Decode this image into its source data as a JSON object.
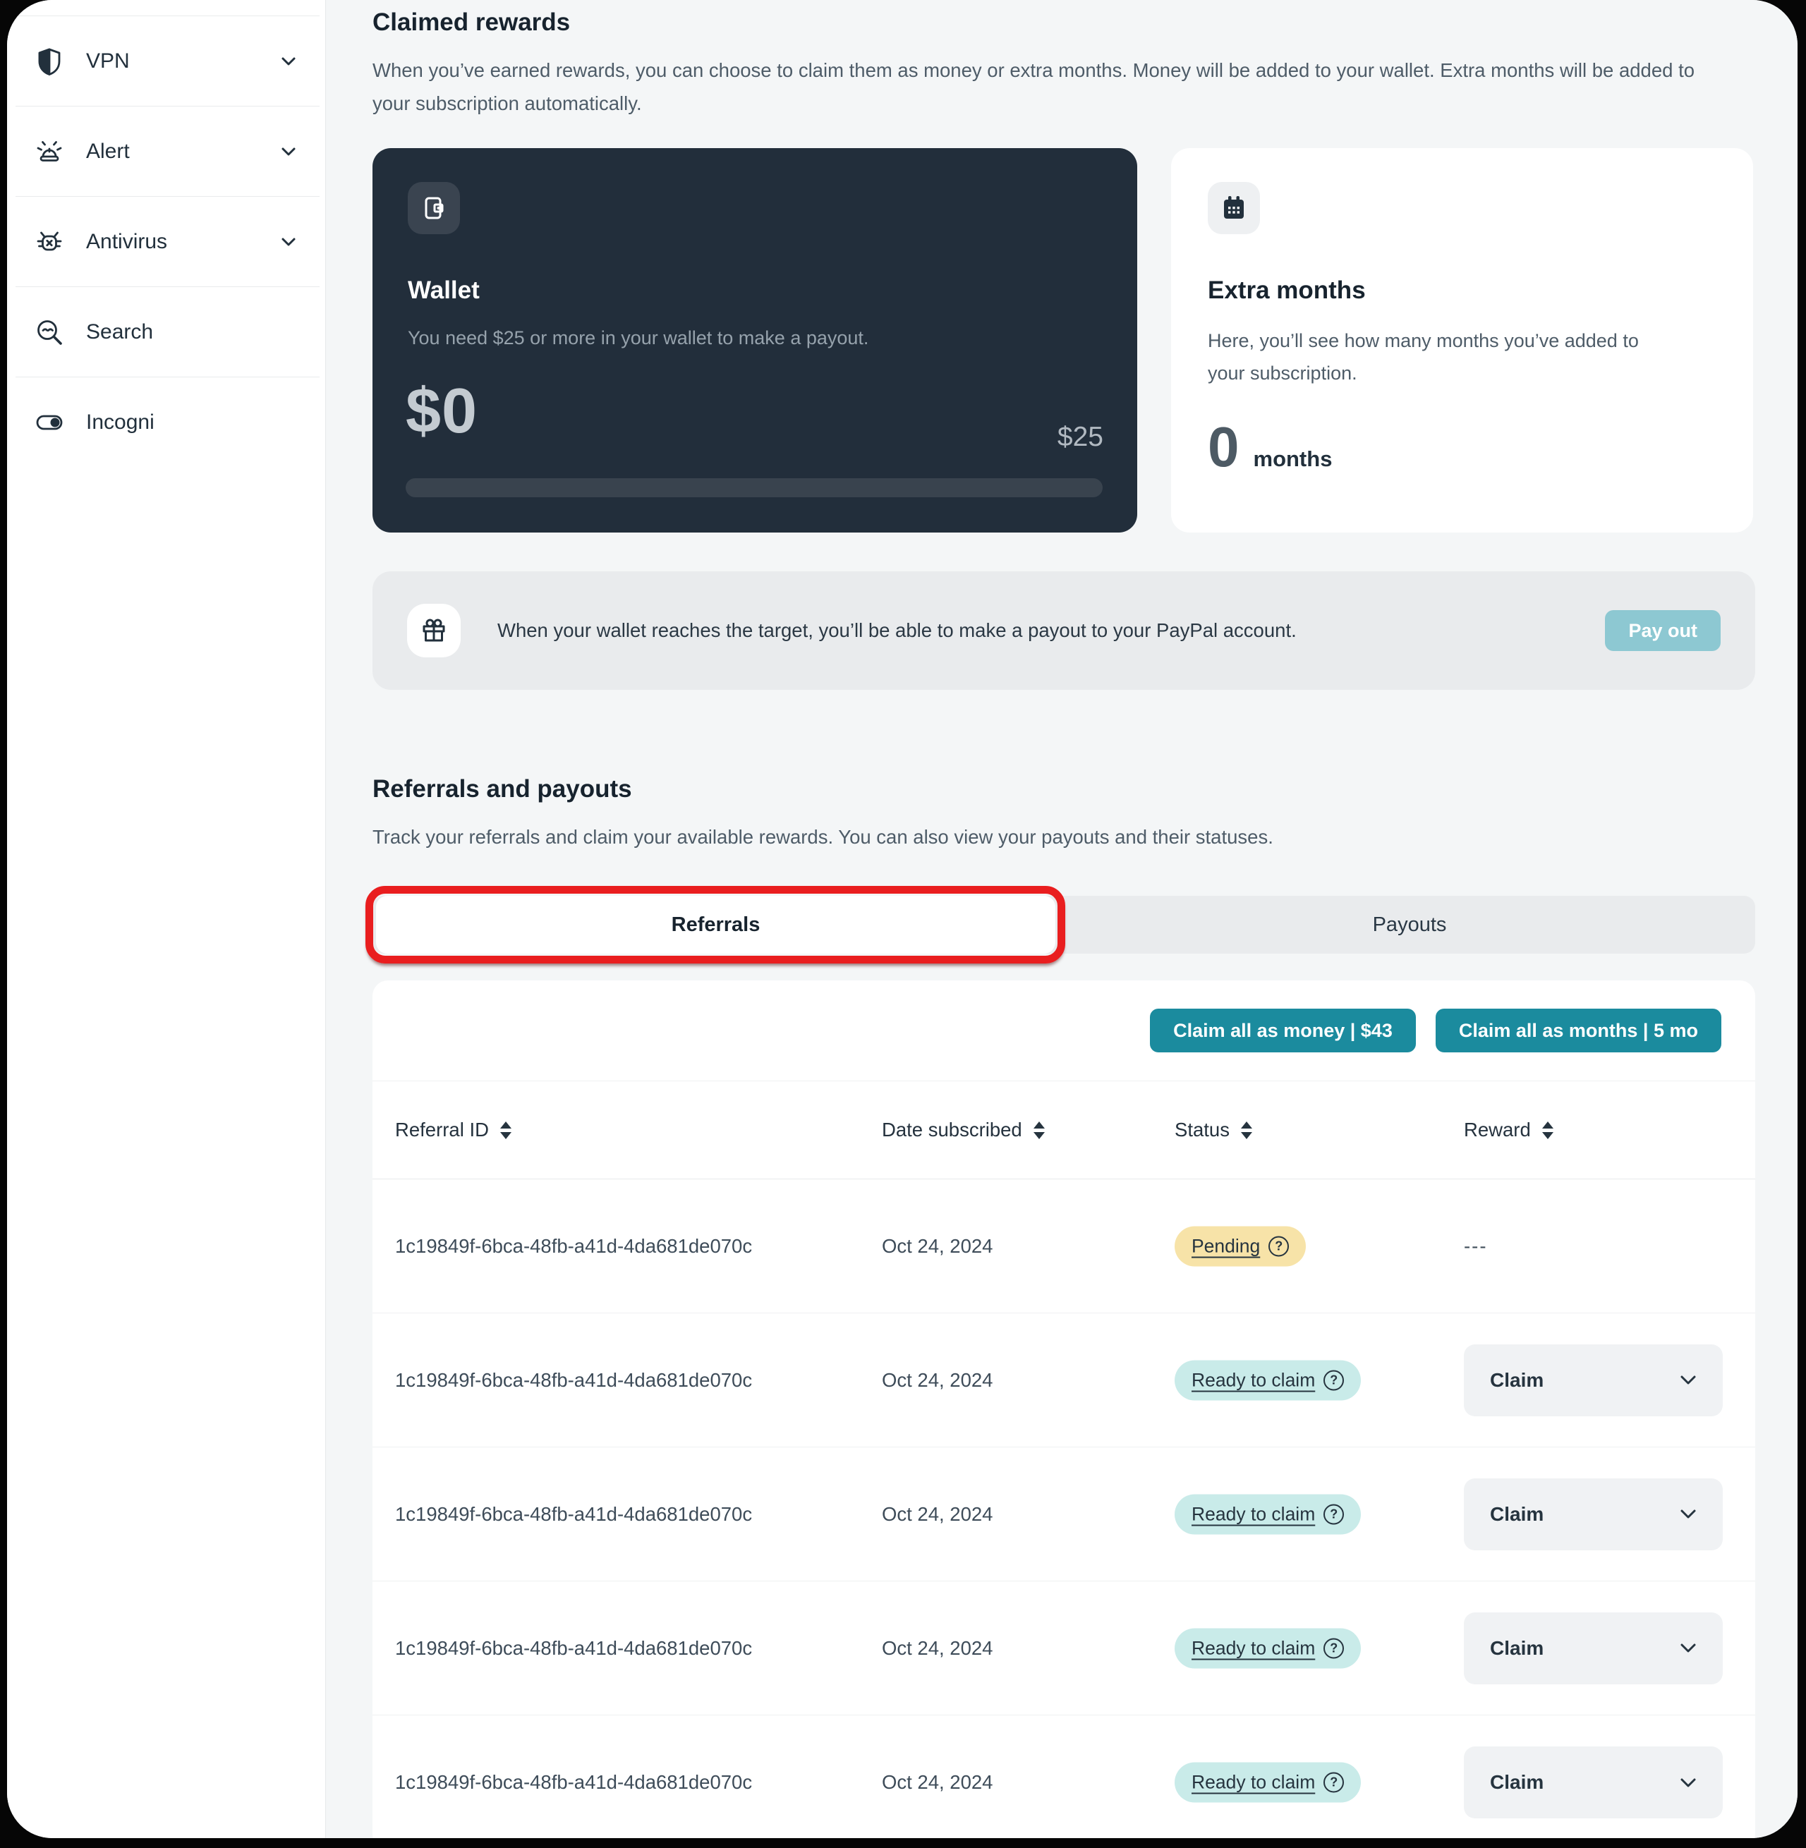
{
  "annotation": {
    "type": "highlight-box",
    "target": "referrals-tab",
    "color": "#e91e1f"
  },
  "sidebar": {
    "items": [
      {
        "label": "VPN",
        "icon": "shield-icon",
        "expandable": true
      },
      {
        "label": "Alert",
        "icon": "siren-icon",
        "expandable": true
      },
      {
        "label": "Antivirus",
        "icon": "bug-icon",
        "expandable": true
      },
      {
        "label": "Search",
        "icon": "search-icon",
        "expandable": false
      },
      {
        "label": "Incogni",
        "icon": "toggle-icon",
        "expandable": false
      }
    ]
  },
  "claimed_rewards": {
    "title": "Claimed rewards",
    "description": "When you’ve earned rewards, you can choose to claim them as money or extra months. Money will be added to your wallet. Extra months will be added to your subscription automatically.",
    "wallet": {
      "title": "Wallet",
      "description": "You need $25 or more in your wallet to make a payout.",
      "amount": "$0",
      "target": "$25",
      "progress_percent": 0
    },
    "extra_months": {
      "title": "Extra months",
      "description": "Here, you’ll see how many months you’ve added to your subscription.",
      "value": "0",
      "unit": "months"
    },
    "payout_banner": {
      "message": "When your wallet reaches the target, you’ll be able to make a payout to your PayPal account.",
      "button_label": "Pay out"
    }
  },
  "referrals_payouts": {
    "title": "Referrals and payouts",
    "description": "Track your referrals and claim your available rewards. You can also view your payouts and their statuses.",
    "tabs": [
      {
        "label": "Referrals",
        "active": true,
        "highlighted": true
      },
      {
        "label": "Payouts",
        "active": false
      }
    ],
    "actions": [
      {
        "label": "Claim all as money | $43"
      },
      {
        "label": "Claim all as months | 5 mo"
      }
    ],
    "table": {
      "columns": [
        {
          "label": "Referral ID",
          "sortable": true
        },
        {
          "label": "Date subscribed",
          "sortable": true
        },
        {
          "label": "Status",
          "sortable": true
        },
        {
          "label": "Reward",
          "sortable": true
        }
      ],
      "rows": [
        {
          "referral_id": "1c19849f-6bca-48fb-a41d-4da681de070c",
          "date_subscribed": "Oct 24, 2024",
          "status": "Pending",
          "status_type": "pending",
          "reward": "---",
          "reward_type": "text"
        },
        {
          "referral_id": "1c19849f-6bca-48fb-a41d-4da681de070c",
          "date_subscribed": "Oct 24, 2024",
          "status": "Ready to claim",
          "status_type": "ready",
          "reward": "Claim",
          "reward_type": "dropdown"
        },
        {
          "referral_id": "1c19849f-6bca-48fb-a41d-4da681de070c",
          "date_subscribed": "Oct 24, 2024",
          "status": "Ready to claim",
          "status_type": "ready",
          "reward": "Claim",
          "reward_type": "dropdown"
        },
        {
          "referral_id": "1c19849f-6bca-48fb-a41d-4da681de070c",
          "date_subscribed": "Oct 24, 2024",
          "status": "Ready to claim",
          "status_type": "ready",
          "reward": "Claim",
          "reward_type": "dropdown"
        },
        {
          "referral_id": "1c19849f-6bca-48fb-a41d-4da681de070c",
          "date_subscribed": "Oct 24, 2024",
          "status": "Ready to claim",
          "status_type": "ready",
          "reward": "Claim",
          "reward_type": "dropdown"
        }
      ]
    }
  },
  "colors": {
    "accent_teal": "#1b8b9e",
    "payout_disabled": "#8dc8d2",
    "wallet_card_bg": "#222e3b",
    "pending_badge_bg": "#f7e3a8",
    "ready_badge_bg": "#c9ebe9",
    "annotation_red": "#e91e1f"
  }
}
